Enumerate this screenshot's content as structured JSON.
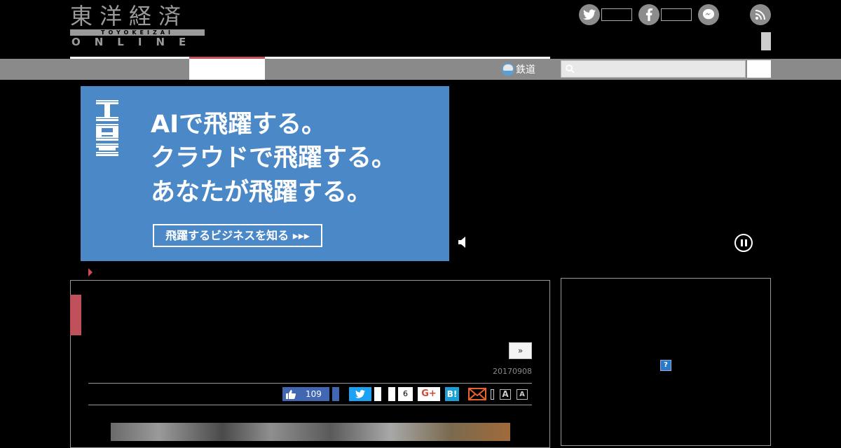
{
  "logo": {
    "kanji": "東洋経済",
    "band": "TOYOKEIZAI",
    "online": "ONLINE"
  },
  "social_header": [
    "twitter-icon",
    "facebook-icon",
    "messenger-icon",
    "rss-icon"
  ],
  "nav": {
    "rail_label": "鉄道",
    "search_placeholder": ""
  },
  "ad": {
    "brand": "IBM",
    "lines": [
      "AIで飛躍する。",
      "クラウドで飛躍する。",
      "あなたが飛躍する。"
    ],
    "cta": "飛躍するビジネスを知る ▸▸▸",
    "bg_color": "#4a88c8"
  },
  "article": {
    "next_label": "»",
    "date": "20170908",
    "accent_color": "#c0505a"
  },
  "share": {
    "like_count": "109",
    "hatena_count": "6",
    "gplus_label": "G+",
    "hatena_label": "B!",
    "font_small": "A",
    "font_large": "A"
  },
  "side": {
    "adchoice_label": "?"
  }
}
